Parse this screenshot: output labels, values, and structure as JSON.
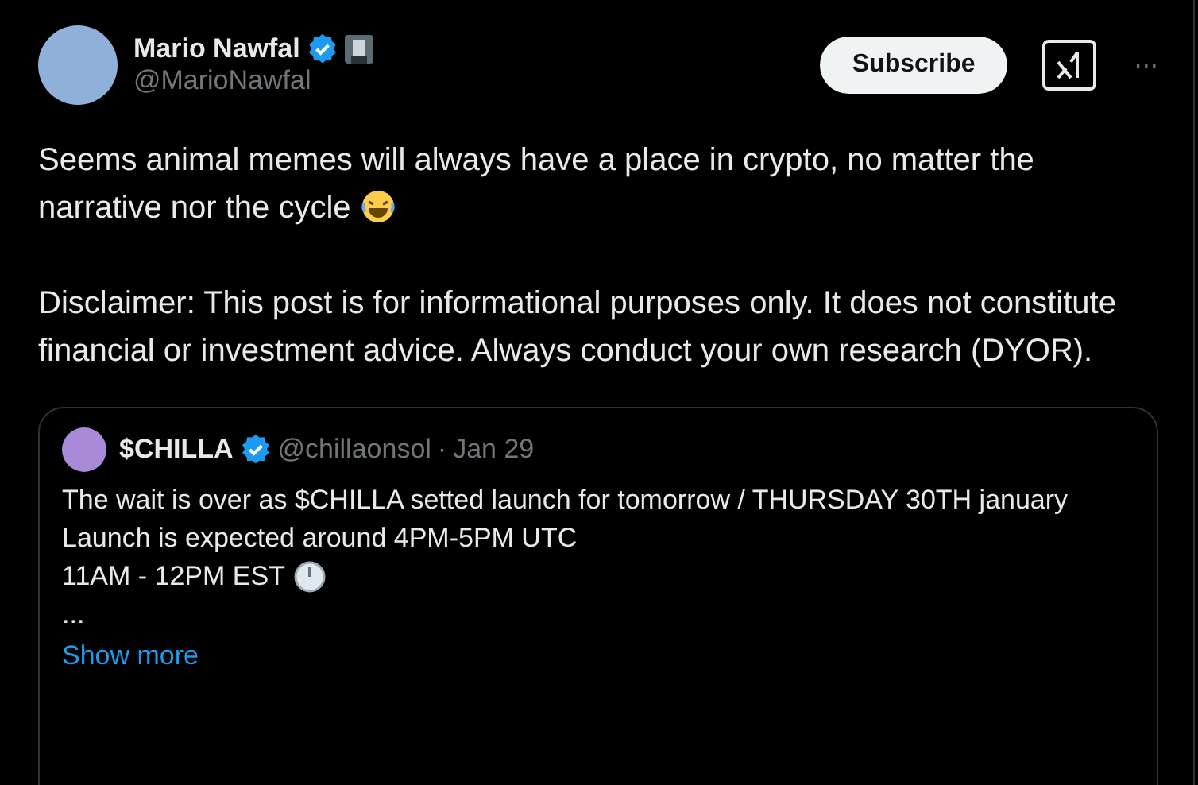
{
  "author": {
    "name": "Mario Nawfal",
    "handle": "@MarioNawfal",
    "verified": true
  },
  "actions": {
    "subscribe": "Subscribe",
    "more": "···"
  },
  "post": {
    "paragraphs": [
      "Seems animal memes will always have a place in crypto, no matter the narrative nor the cycle",
      "Disclaimer: This post is for informational purposes only. It does not constitute financial or investment advice. Always conduct your own research (DYOR)."
    ]
  },
  "quote": {
    "name": "$CHILLA",
    "verified": true,
    "handle": "@chillaonsol",
    "separator": "·",
    "date": "Jan 29",
    "lines": [
      "The wait is over as $CHILLA setted launch for tomorrow / THURSDAY 30TH january",
      "Launch is expected around 4PM-5PM UTC",
      "11AM - 12PM EST",
      "..."
    ],
    "show_more": "Show more"
  }
}
